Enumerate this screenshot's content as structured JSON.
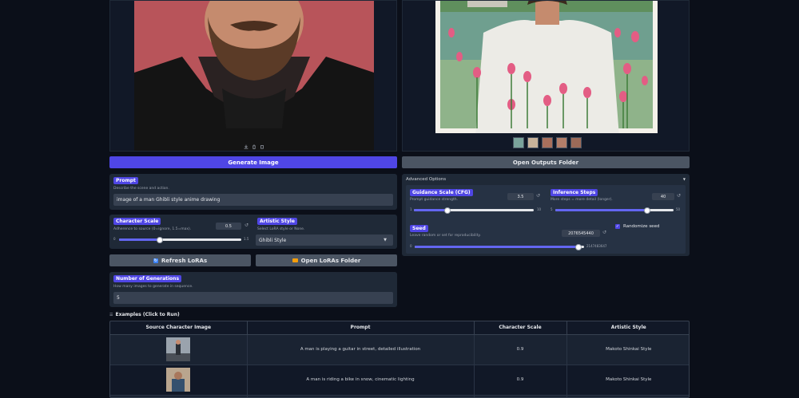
{
  "left_image": {
    "toolbar_icons": [
      "download-icon",
      "trash-icon",
      "copy-icon"
    ]
  },
  "right_gallery": {
    "thumbnail_count": 5
  },
  "generate_label": "Generate Image",
  "open_outputs_label": "Open Outputs Folder",
  "prompt": {
    "label": "Prompt",
    "hint": "Describe the scene and action.",
    "value": "image of a man Ghibli style anime drawing"
  },
  "character_scale": {
    "label": "Character Scale",
    "hint": "Adherence to source (0=ignore, 1.5=max).",
    "value": "0.5",
    "min": "0",
    "max": "1.5",
    "fraction": 0.333
  },
  "artistic_style": {
    "label": "Artistic Style",
    "hint": "Select LoRA style or None.",
    "value": "Ghibli Style"
  },
  "refresh_loras_label": "Refresh LoRAs",
  "open_loras_label": "Open LoRAs Folder",
  "num_generations": {
    "label": "Number of Generations",
    "hint": "How many images to generate in sequence.",
    "value": "5"
  },
  "advanced": {
    "title": "Advanced Options",
    "guidance": {
      "label": "Guidance Scale (CFG)",
      "hint": "Prompt guidance strength.",
      "value": "3.5",
      "min": "1",
      "max": "10",
      "fraction": 0.278
    },
    "steps": {
      "label": "Inference Steps",
      "hint": "More steps = more detail (longer).",
      "value": "40",
      "min": "5",
      "max": "50",
      "fraction": 0.778
    },
    "randomize_label": "Randomize seed",
    "seed": {
      "label": "Seed",
      "hint": "Leave random or set for reproducibility.",
      "value": "2076545440",
      "min": "0",
      "max": "2147483647",
      "fraction": 0.966
    }
  },
  "examples": {
    "title": "Examples (Click to Run)",
    "headers": [
      "Source Character Image",
      "Prompt",
      "Character Scale",
      "Artistic Style"
    ],
    "rows": [
      {
        "prompt": "A man is playing a guitar in street, detailed illustration",
        "scale": "0.9",
        "style": "Makoto Shinkai Style"
      },
      {
        "prompt": "A man is riding a bike in snow, cinematic lighting",
        "scale": "0.9",
        "style": "Makoto Shinkai Style"
      }
    ]
  },
  "colors": {
    "accent": "#4f46e5",
    "panel": "#1f2937",
    "background": "#0b0f19"
  }
}
